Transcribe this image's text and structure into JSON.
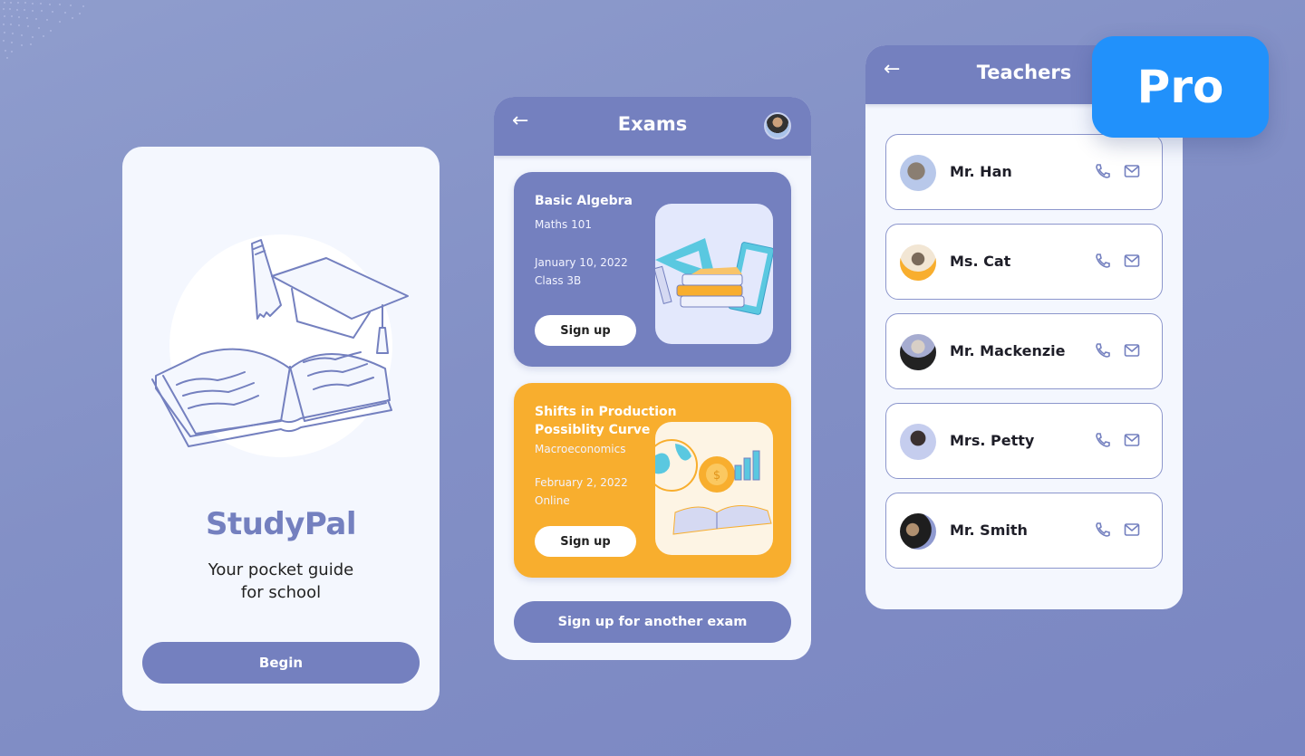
{
  "colors": {
    "primary": "#7480bf",
    "accent_orange": "#f8ae2e",
    "pro_blue": "#2191fb",
    "screen_bg": "#f4f7fe"
  },
  "welcome_screen": {
    "illustration": "book-pencil-graduation-cap-illustration",
    "brand": "StudyPal",
    "tagline_line1": "Your pocket guide",
    "tagline_line2": "for school",
    "begin_label": "Begin"
  },
  "exams_screen": {
    "back_icon": "arrow-left-icon",
    "title": "Exams",
    "avatar": "user-avatar",
    "exams": [
      {
        "title": "Basic Algebra",
        "course": "Maths 101",
        "date": "January 10, 2022",
        "location": "Class 3B",
        "signup_label": "Sign up",
        "illustration": "math-books-abacus-illustration"
      },
      {
        "title": "Shifts in Production Possiblity Curve",
        "course": "Macroeconomics",
        "date": "February 2, 2022",
        "location": "Online",
        "signup_label": "Sign up",
        "illustration": "economics-globe-book-illustration"
      }
    ],
    "another_label": "Sign up for another exam"
  },
  "teachers_screen": {
    "back_icon": "arrow-left-icon",
    "title": "Teachers",
    "teachers": [
      {
        "name": "Mr. Han",
        "actions": [
          "phone-icon",
          "mail-icon"
        ]
      },
      {
        "name": "Ms. Cat",
        "actions": [
          "phone-icon",
          "mail-icon"
        ]
      },
      {
        "name": "Mr. Mackenzie",
        "actions": [
          "phone-icon",
          "mail-icon"
        ]
      },
      {
        "name": "Mrs. Petty",
        "actions": [
          "phone-icon",
          "mail-icon"
        ]
      },
      {
        "name": "Mr. Smith",
        "actions": [
          "phone-icon",
          "mail-icon"
        ]
      }
    ]
  },
  "badge": {
    "label": "Pro"
  }
}
